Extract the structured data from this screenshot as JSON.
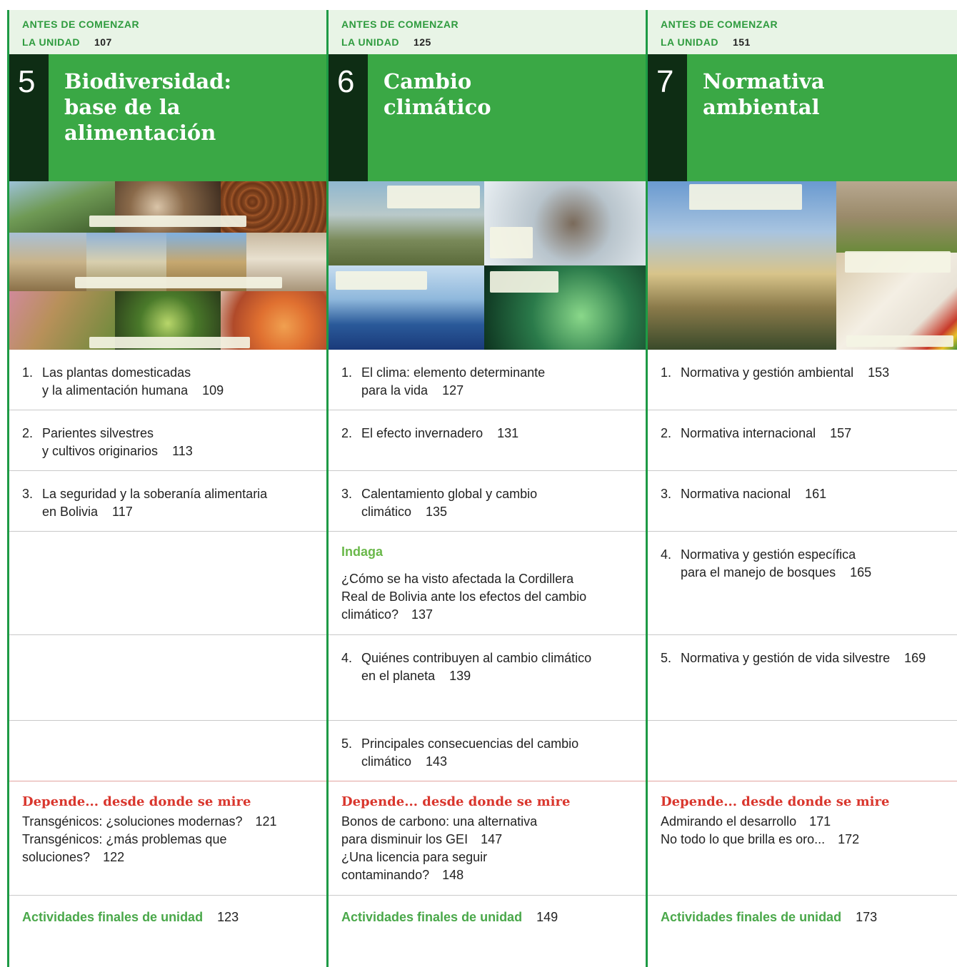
{
  "units": [
    {
      "antes": "ANTES DE COMENZAR",
      "la_unidad": "LA UNIDAD",
      "antes_page": "107",
      "number": "5",
      "title_line1": "Biodiversidad:",
      "title_line2": "base de la alimentación",
      "items": [
        {
          "n": "1.",
          "l1": "Las plantas domesticadas",
          "l2": "y la alimentación humana",
          "page": "109"
        },
        {
          "n": "2.",
          "l1": "Parientes silvestres",
          "l2": "y cultivos originarios",
          "page": "113"
        },
        {
          "n": "3.",
          "l1": "La seguridad y la soberanía alimentaria",
          "l2": "en Bolivia",
          "page": "117"
        }
      ],
      "depende_title": "Depende... desde donde se mire",
      "depende_lines": [
        {
          "text": "Transgénicos: ¿soluciones modernas?",
          "page": "121"
        },
        {
          "text": "Transgénicos: ¿más problemas que",
          "page": ""
        },
        {
          "text": "soluciones?",
          "page": "122"
        }
      ],
      "activities_label": "Actividades finales de unidad",
      "activities_page": "123"
    },
    {
      "antes": "ANTES DE COMENZAR",
      "la_unidad": "LA UNIDAD",
      "antes_page": "125",
      "number": "6",
      "title_line1": "Cambio",
      "title_line2": "climático",
      "items": [
        {
          "n": "1.",
          "l1": "El clima: elemento determinante",
          "l2": "para la vida",
          "page": "127"
        },
        {
          "n": "2.",
          "l1": "El efecto invernadero",
          "l2": "",
          "page": "131"
        },
        {
          "n": "3.",
          "l1": "Calentamiento global y cambio",
          "l2": "climático",
          "page": "135"
        }
      ],
      "indaga_label": "Indaga",
      "indaga_lines": [
        "¿Cómo se ha visto afectada la Cordillera",
        "Real de Bolivia ante los efectos del cambio",
        "climático?"
      ],
      "indaga_page": "137",
      "items2": [
        {
          "n": "4.",
          "l1": "Quiénes contribuyen al cambio climático",
          "l2": "en el planeta",
          "page": "139"
        },
        {
          "n": "5.",
          "l1": "Principales consecuencias del cambio",
          "l2": "climático",
          "page": "143"
        }
      ],
      "depende_title": "Depende... desde donde se mire",
      "depende_lines": [
        {
          "text": "Bonos de carbono: una alternativa",
          "page": ""
        },
        {
          "text": "para disminuir los GEI",
          "page": "147"
        },
        {
          "text": "¿Una licencia para seguir",
          "page": ""
        },
        {
          "text": "contaminando?",
          "page": "148"
        }
      ],
      "activities_label": "Actividades finales de unidad",
      "activities_page": "149"
    },
    {
      "antes": "ANTES DE COMENZAR",
      "la_unidad": "LA UNIDAD",
      "antes_page": "151",
      "number": "7",
      "title_line1": "Normativa",
      "title_line2": "ambiental",
      "items": [
        {
          "n": "1.",
          "l1": "Normativa y gestión ambiental",
          "l2": "",
          "page": "153"
        },
        {
          "n": "2.",
          "l1": "Normativa internacional",
          "l2": "",
          "page": "157"
        },
        {
          "n": "3.",
          "l1": "Normativa nacional",
          "l2": "",
          "page": "161"
        },
        {
          "n": "4.",
          "l1": "Normativa y gestión específica",
          "l2": "para el manejo de bosques",
          "page": "165"
        },
        {
          "n": "5.",
          "l1": "Normativa y gestión de vida silvestre",
          "l2": "",
          "page": "169"
        }
      ],
      "depende_title": "Depende... desde donde se mire",
      "depende_lines": [
        {
          "text": "Admirando el desarrollo",
          "page": "171"
        },
        {
          "text": "No todo lo que brilla es oro...",
          "page": "172"
        }
      ],
      "activities_label": "Actividades finales de unidad",
      "activities_page": "173"
    }
  ],
  "colors": {
    "green_accent": "#2e9b3e",
    "banner_green": "#3aa845",
    "dark_box": "#0e2d14",
    "red": "#d9362d",
    "indaga_green": "#6ab84a"
  }
}
